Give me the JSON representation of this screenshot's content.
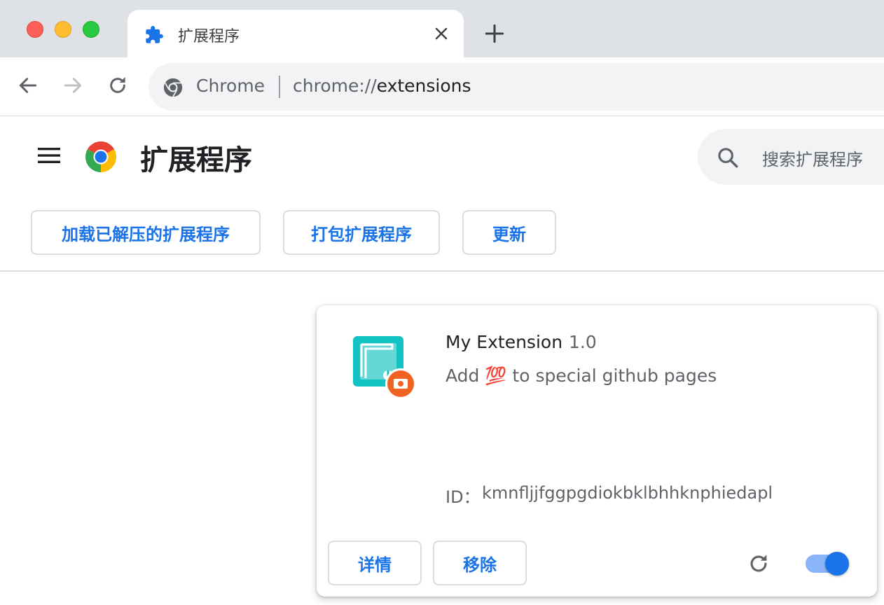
{
  "browser": {
    "tab": {
      "title": "扩展程序",
      "icon": "puzzle-icon"
    },
    "omnibox": {
      "site_label": "Chrome",
      "url_scheme": "chrome://",
      "url_host": "extensions"
    }
  },
  "header": {
    "title": "扩展程序",
    "search_placeholder": "搜索扩展程序"
  },
  "dev_toolbar": {
    "load_unpacked_label": "加载已解压的扩展程序",
    "pack_label": "打包扩展程序",
    "update_label": "更新"
  },
  "extension": {
    "name": "My Extension",
    "version": "1.0",
    "description": "Add 💯 to special github pages",
    "id_label": "ID：",
    "id": "kmnfljjfggpgdiokbklbhhknphiedapl",
    "details_label": "详情",
    "remove_label": "移除",
    "enabled": true
  },
  "colors": {
    "accent": "#1a73e8",
    "toggle_track": "#8ab4f8",
    "tabstrip": "#dee1e6",
    "omnibox_bg": "#f1f3f4"
  }
}
